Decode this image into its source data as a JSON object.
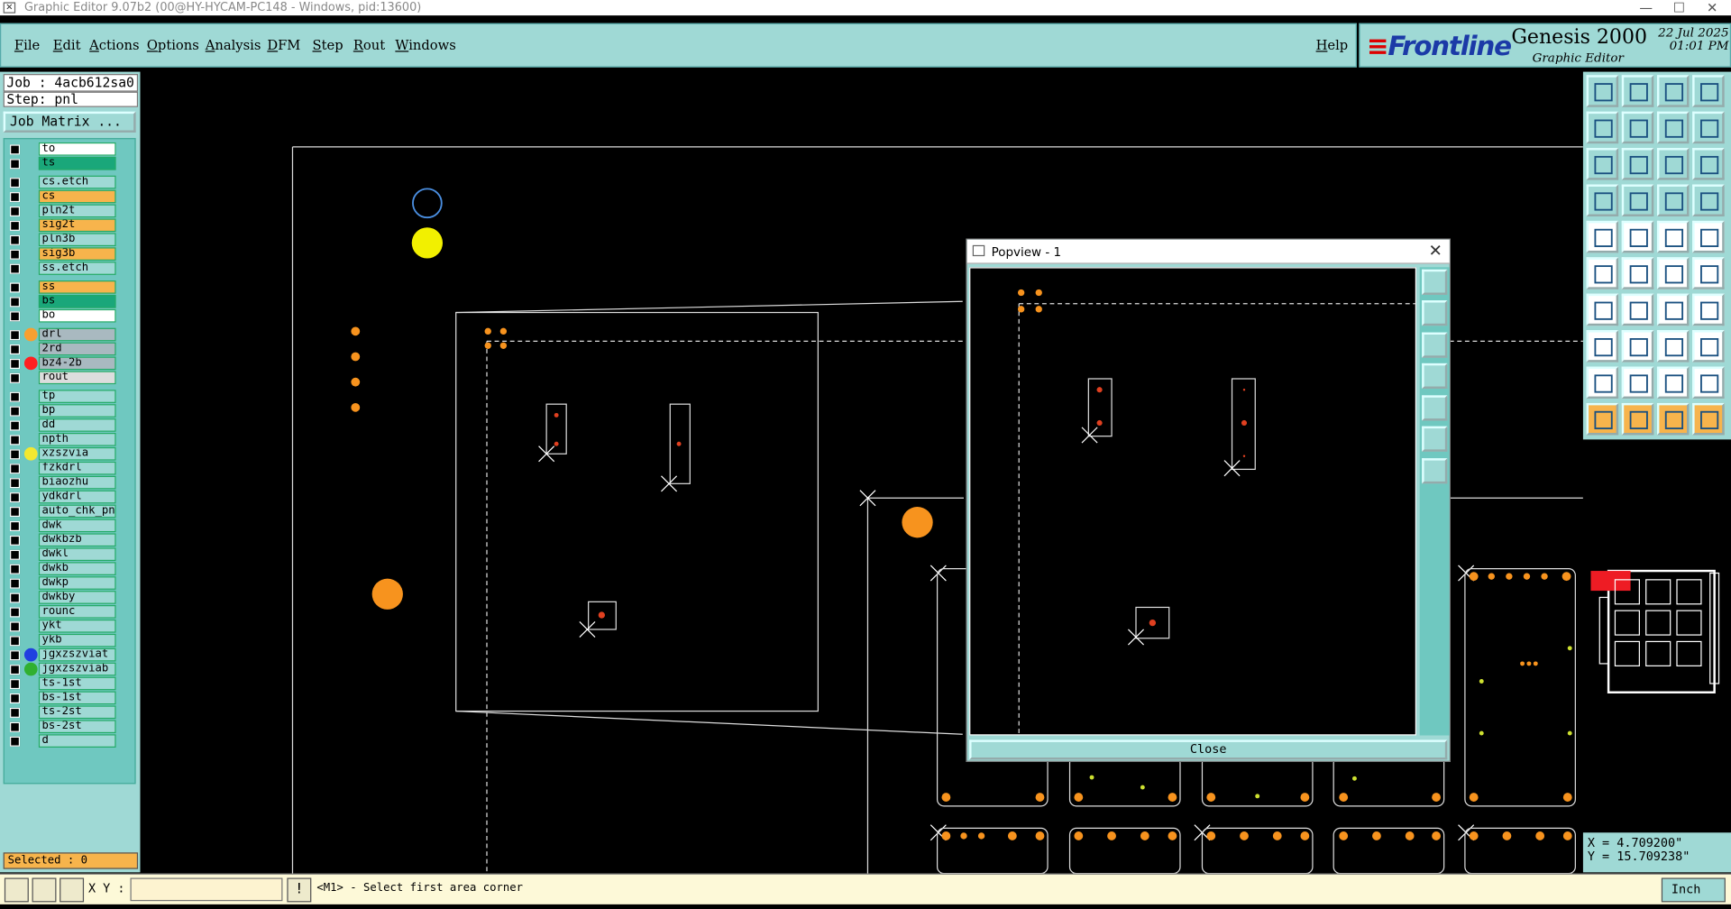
{
  "window": {
    "title": "Graphic Editor 9.07b2 (00@HY-HYCAM-PC148 - Windows, pid:13600)"
  },
  "menu": {
    "items": [
      "File",
      "Edit",
      "Actions",
      "Options",
      "Analysis",
      "DFM",
      "Step",
      "Rout",
      "Windows"
    ],
    "help": "Help"
  },
  "brand": {
    "logo": "Frontline",
    "product": "Genesis 2000",
    "subtitle": "Graphic Editor",
    "date": "22 Jul 2025",
    "time": "01:01 PM"
  },
  "job": {
    "job_text": "Job : 4acb612sa0",
    "step_text": "Step: pnl",
    "matrix_button": "Job Matrix ..."
  },
  "layers": [
    {
      "name": "to",
      "bg": "#ffffff",
      "dot": ""
    },
    {
      "name": "ts",
      "bg": "#1aa77a",
      "dot": ""
    },
    {
      "name": "cs.etch",
      "bg": "#9fd9d5",
      "dot": ""
    },
    {
      "name": "cs",
      "bg": "#f7b44c",
      "dot": ""
    },
    {
      "name": "pln2t",
      "bg": "#9fd9d5",
      "dot": ""
    },
    {
      "name": "sig2t",
      "bg": "#f7b44c",
      "dot": ""
    },
    {
      "name": "pln3b",
      "bg": "#9fd9d5",
      "dot": ""
    },
    {
      "name": "sig3b",
      "bg": "#f7b44c",
      "dot": ""
    },
    {
      "name": "ss.etch",
      "bg": "#9fd9d5",
      "dot": ""
    },
    {
      "name": "ss",
      "bg": "#f7b44c",
      "dot": ""
    },
    {
      "name": "bs",
      "bg": "#1aa77a",
      "dot": ""
    },
    {
      "name": "bo",
      "bg": "#ffffff",
      "dot": ""
    },
    {
      "name": "drl",
      "bg": "#a9b9c0",
      "dot": "#f7a030"
    },
    {
      "name": "2rd",
      "bg": "#a9b9c0",
      "dot": ""
    },
    {
      "name": "bz4-2b",
      "bg": "#a9b9c0",
      "dot": "#ff2020"
    },
    {
      "name": "rout",
      "bg": "#dddddd",
      "dot": ""
    },
    {
      "name": "tp",
      "bg": "#9fd9d5",
      "dot": ""
    },
    {
      "name": "bp",
      "bg": "#9fd9d5",
      "dot": ""
    },
    {
      "name": "dd",
      "bg": "#9fd9d5",
      "dot": ""
    },
    {
      "name": "npth",
      "bg": "#9fd9d5",
      "dot": ""
    },
    {
      "name": "xzszvia",
      "bg": "#9fd9d5",
      "dot": "#f2e830"
    },
    {
      "name": "fzkdrl",
      "bg": "#9fd9d5",
      "dot": ""
    },
    {
      "name": "biaozhu",
      "bg": "#9fd9d5",
      "dot": ""
    },
    {
      "name": "ydkdrl",
      "bg": "#9fd9d5",
      "dot": ""
    },
    {
      "name": "auto_chk_pn",
      "bg": "#9fd9d5",
      "dot": ""
    },
    {
      "name": "dwk",
      "bg": "#9fd9d5",
      "dot": ""
    },
    {
      "name": "dwkbzb",
      "bg": "#9fd9d5",
      "dot": ""
    },
    {
      "name": "dwkl",
      "bg": "#9fd9d5",
      "dot": ""
    },
    {
      "name": "dwkb",
      "bg": "#9fd9d5",
      "dot": ""
    },
    {
      "name": "dwkp",
      "bg": "#9fd9d5",
      "dot": ""
    },
    {
      "name": "dwkby",
      "bg": "#9fd9d5",
      "dot": ""
    },
    {
      "name": "rounc",
      "bg": "#9fd9d5",
      "dot": ""
    },
    {
      "name": "ykt",
      "bg": "#9fd9d5",
      "dot": ""
    },
    {
      "name": "ykb",
      "bg": "#9fd9d5",
      "dot": ""
    },
    {
      "name": "jgxzszviat",
      "bg": "#9fd9d5",
      "dot": "#2040e0"
    },
    {
      "name": "jgxzszviab",
      "bg": "#9fd9d5",
      "dot": "#30b030"
    },
    {
      "name": "ts-1st",
      "bg": "#9fd9d5",
      "dot": ""
    },
    {
      "name": "bs-1st",
      "bg": "#9fd9d5",
      "dot": ""
    },
    {
      "name": "ts-2st",
      "bg": "#9fd9d5",
      "dot": ""
    },
    {
      "name": "bs-2st",
      "bg": "#9fd9d5",
      "dot": ""
    },
    {
      "name": "d",
      "bg": "#9fd9d5",
      "dot": ""
    }
  ],
  "selection": {
    "text": "Selected : 0"
  },
  "popview": {
    "title": "Popview - 1",
    "close_label": "Close"
  },
  "coords": {
    "x_text": "X = 4.709200\"",
    "y_text": "Y = 15.709238\""
  },
  "bottom": {
    "xy_label": "X Y :",
    "xy_value": "",
    "status": "<M1> - Select first area corner",
    "units": "Inch"
  },
  "colors": {
    "panel": "#9fd9d5",
    "orange": "#f7931e",
    "yellow": "#f2f000"
  }
}
